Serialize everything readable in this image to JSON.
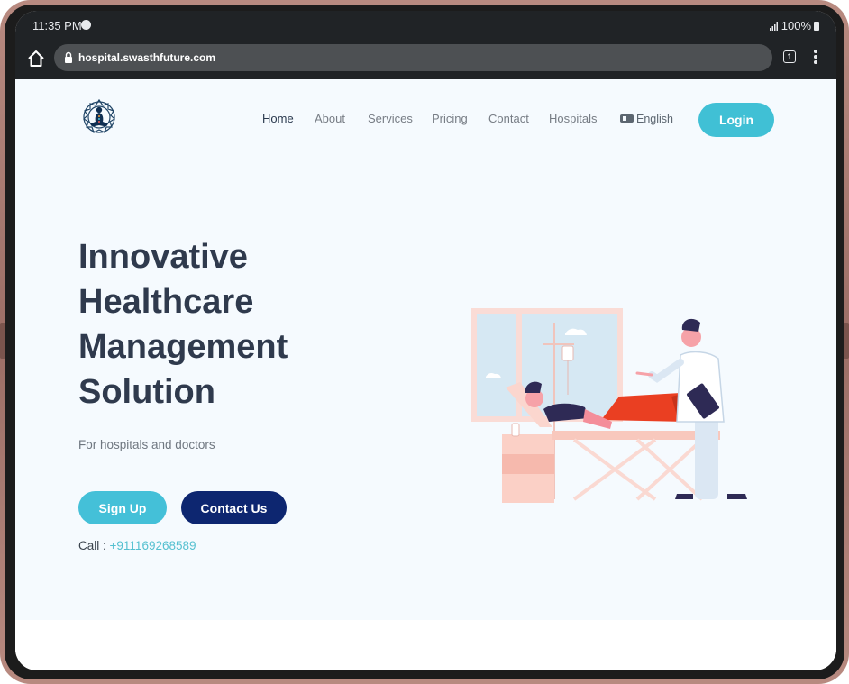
{
  "status_bar": {
    "time": "11:35 PM",
    "battery": "100%",
    "icons": [
      "spotify-icon",
      "signal-icon",
      "battery-icon"
    ]
  },
  "browser": {
    "url": "hospital.swasthfuture.com",
    "tab_count": "1",
    "icons": [
      "home-icon",
      "lock-icon",
      "tabs-icon",
      "menu-icon"
    ]
  },
  "nav": {
    "items": [
      {
        "label": "Home",
        "active": true
      },
      {
        "label": "About"
      },
      {
        "label": "Services"
      },
      {
        "label": "Pricing"
      },
      {
        "label": "Contact"
      },
      {
        "label": "Hospitals"
      }
    ],
    "language": "English",
    "login_label": "Login"
  },
  "hero": {
    "title_lines": [
      "Innovative",
      "Healthcare",
      "Management",
      "Solution"
    ],
    "subtitle": "For hospitals and doctors",
    "signup_label": "Sign Up",
    "contact_label": "Contact Us",
    "call_label": "Call :",
    "phone": "+911169268589"
  },
  "colors": {
    "accent": "#40c0d5",
    "navy": "#0d2670",
    "heading": "#2f3a4d",
    "page_bg": "#f5fafe",
    "frame": "#b88a80"
  }
}
